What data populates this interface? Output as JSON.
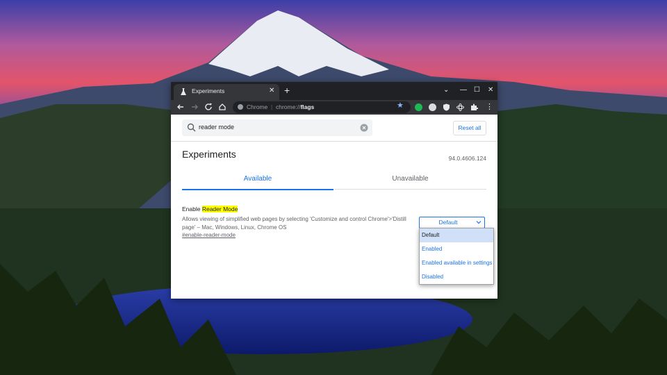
{
  "browser": {
    "tab_title": "Experiments",
    "omnibox": {
      "scheme_label": "Chrome",
      "separator": "|",
      "url_prefix": "chrome://",
      "url_path": "flags"
    }
  },
  "page": {
    "search": {
      "value": "reader mode"
    },
    "reset_all_label": "Reset all",
    "title": "Experiments",
    "version": "94.0.4606.124",
    "tabs": [
      {
        "label": "Available",
        "active": true
      },
      {
        "label": "Unavailable",
        "active": false
      }
    ],
    "experiment": {
      "title_prefix": "Enable ",
      "title_highlight": "Reader Mode",
      "description_line1": "Allows viewing of simplified web pages by selecting 'Customize and control Chrome'>'Distill",
      "description_line2": "page' – Mac, Windows, Linux, Chrome OS",
      "link": "#enable-reader-mode",
      "select_value": "Default",
      "options": [
        "Default",
        "Enabled",
        "Enabled available in settings",
        "Disabled"
      ],
      "selected_option": "Default"
    }
  },
  "colors": {
    "accent": "#1a73e8",
    "highlight": "#ffff00",
    "tabstrip": "#202124",
    "toolbar": "#35363a"
  }
}
